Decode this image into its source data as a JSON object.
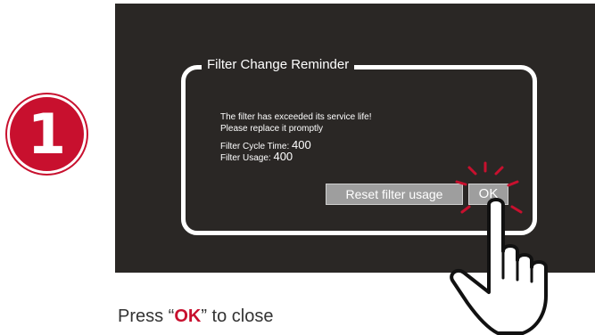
{
  "step": {
    "number": "1"
  },
  "dialog": {
    "title": "Filter Change Reminder",
    "message_line1": "The filter has exceeded its service life!",
    "message_line2": "Please replace it promptly",
    "cycle_label": "Filter Cycle Time:",
    "cycle_value": "400",
    "usage_label": "Filter Usage:",
    "usage_value": "400",
    "reset_button": "Reset filter usage",
    "ok_button": "OK"
  },
  "caption": {
    "prefix": "Press “",
    "highlight": "OK",
    "suffix": "” to close"
  },
  "colors": {
    "accent": "#c8102e",
    "screen_bg": "#2a2725",
    "button_bg": "#9e9e9e"
  },
  "icons": {
    "step_badge": "number-one-badge",
    "pointer": "hand-pointer-icon"
  }
}
